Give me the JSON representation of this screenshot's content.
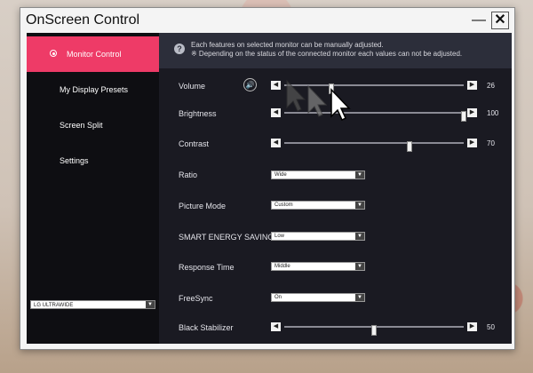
{
  "window": {
    "title": "OnScreen Control",
    "minimize": "—",
    "close": "✕"
  },
  "sidebar": {
    "items": [
      {
        "label": "Monitor Control",
        "active": true
      },
      {
        "label": "My Display Presets",
        "active": false
      },
      {
        "label": "Screen Split",
        "active": false
      },
      {
        "label": "Settings",
        "active": false
      }
    ],
    "monitor_select": {
      "value": "LG ULTRAWIDE"
    }
  },
  "notice": {
    "line1": "Each features on selected monitor can be manually adjusted.",
    "line2": "※ Depending on the status of the connected monitor each values can not be adjusted."
  },
  "settings": {
    "volume": {
      "label": "Volume",
      "value": "26",
      "level": 26
    },
    "brightness": {
      "label": "Brightness",
      "value": "100",
      "level": 100
    },
    "contrast": {
      "label": "Contrast",
      "value": "70",
      "level": 70
    },
    "ratio": {
      "label": "Ratio",
      "value": "Wide"
    },
    "picture_mode": {
      "label": "Picture Mode",
      "value": "Custom"
    },
    "smart_energy": {
      "label": "SMART ENERGY SAVING",
      "value": "Low"
    },
    "response_time": {
      "label": "Response Time",
      "value": "Middle"
    },
    "freesync": {
      "label": "FreeSync",
      "value": "On"
    },
    "black_stabilizer": {
      "label": "Black Stabilizer",
      "value": "50",
      "level": 50
    }
  },
  "icons": {
    "help": "?",
    "speaker": "🔊",
    "arrow_left": "◀",
    "arrow_right": "▶",
    "dropdown": "▼"
  },
  "colors": {
    "accent": "#ee3b67",
    "panel": "#1a1a22",
    "sidebar": "#0e0e12"
  }
}
